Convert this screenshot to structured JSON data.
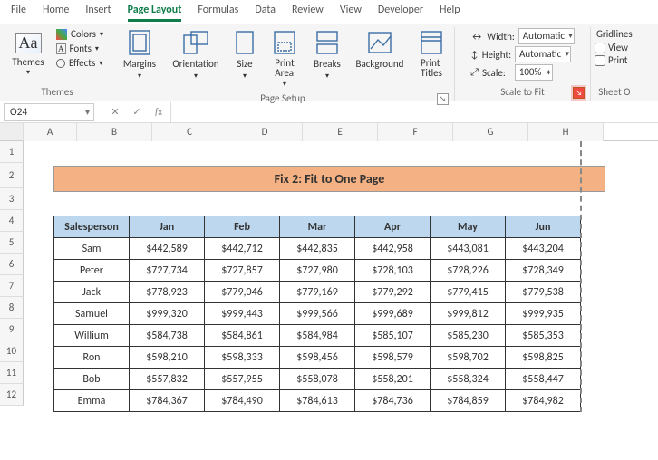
{
  "menu": {
    "items": [
      "File",
      "Home",
      "Insert",
      "Page Layout",
      "Formulas",
      "Data",
      "Review",
      "View",
      "Developer",
      "Help"
    ],
    "active": 3
  },
  "ribbon": {
    "themes": {
      "label": "Themes",
      "colors": "Colors",
      "fonts": "Fonts",
      "effects": "Effects",
      "btn": "Themes"
    },
    "pagesetup": {
      "label": "Page Setup",
      "margins": "Margins",
      "orientation": "Orientation",
      "size": "Size",
      "printarea": "Print\nArea",
      "breaks": "Breaks",
      "background": "Background",
      "printtitles": "Print\nTitles"
    },
    "scale": {
      "label": "Scale to Fit",
      "width": "Width:",
      "height": "Height:",
      "scale": "Scale:",
      "auto": "Automatic",
      "pct": "100%"
    },
    "sheet": {
      "label": "Sheet O",
      "gridlines": "Gridlines",
      "view": "View",
      "print": "Print"
    }
  },
  "namebox": "O24",
  "grid": {
    "cols": [
      "A",
      "B",
      "C",
      "D",
      "E",
      "F",
      "G",
      "H"
    ],
    "rows": [
      "1",
      "2",
      "3",
      "4",
      "5",
      "6",
      "7",
      "8",
      "9",
      "10",
      "11",
      "12"
    ],
    "title": "Fix 2: Fit to One Page"
  },
  "chart_data": {
    "type": "table",
    "title": "Fix 2: Fit to One Page",
    "headers": [
      "Salesperson",
      "Jan",
      "Feb",
      "Mar",
      "Apr",
      "May",
      "Jun"
    ],
    "rows": [
      [
        "Sam",
        "$442,589",
        "$442,712",
        "$442,835",
        "$442,958",
        "$443,081",
        "$443,204"
      ],
      [
        "Peter",
        "$727,734",
        "$727,857",
        "$727,980",
        "$728,103",
        "$728,226",
        "$728,349"
      ],
      [
        "Jack",
        "$778,923",
        "$779,046",
        "$779,169",
        "$779,292",
        "$779,415",
        "$779,538"
      ],
      [
        "Samuel",
        "$999,320",
        "$999,443",
        "$999,566",
        "$999,689",
        "$999,812",
        "$999,935"
      ],
      [
        "Willium",
        "$584,738",
        "$584,861",
        "$584,984",
        "$585,107",
        "$585,230",
        "$585,353"
      ],
      [
        "Ron",
        "$598,210",
        "$598,333",
        "$598,456",
        "$598,579",
        "$598,702",
        "$598,825"
      ],
      [
        "Bob",
        "$557,832",
        "$557,955",
        "$558,078",
        "$558,201",
        "$558,324",
        "$558,447"
      ],
      [
        "Emma",
        "$784,367",
        "$784,490",
        "$784,613",
        "$784,736",
        "$784,859",
        "$784,982"
      ]
    ]
  }
}
